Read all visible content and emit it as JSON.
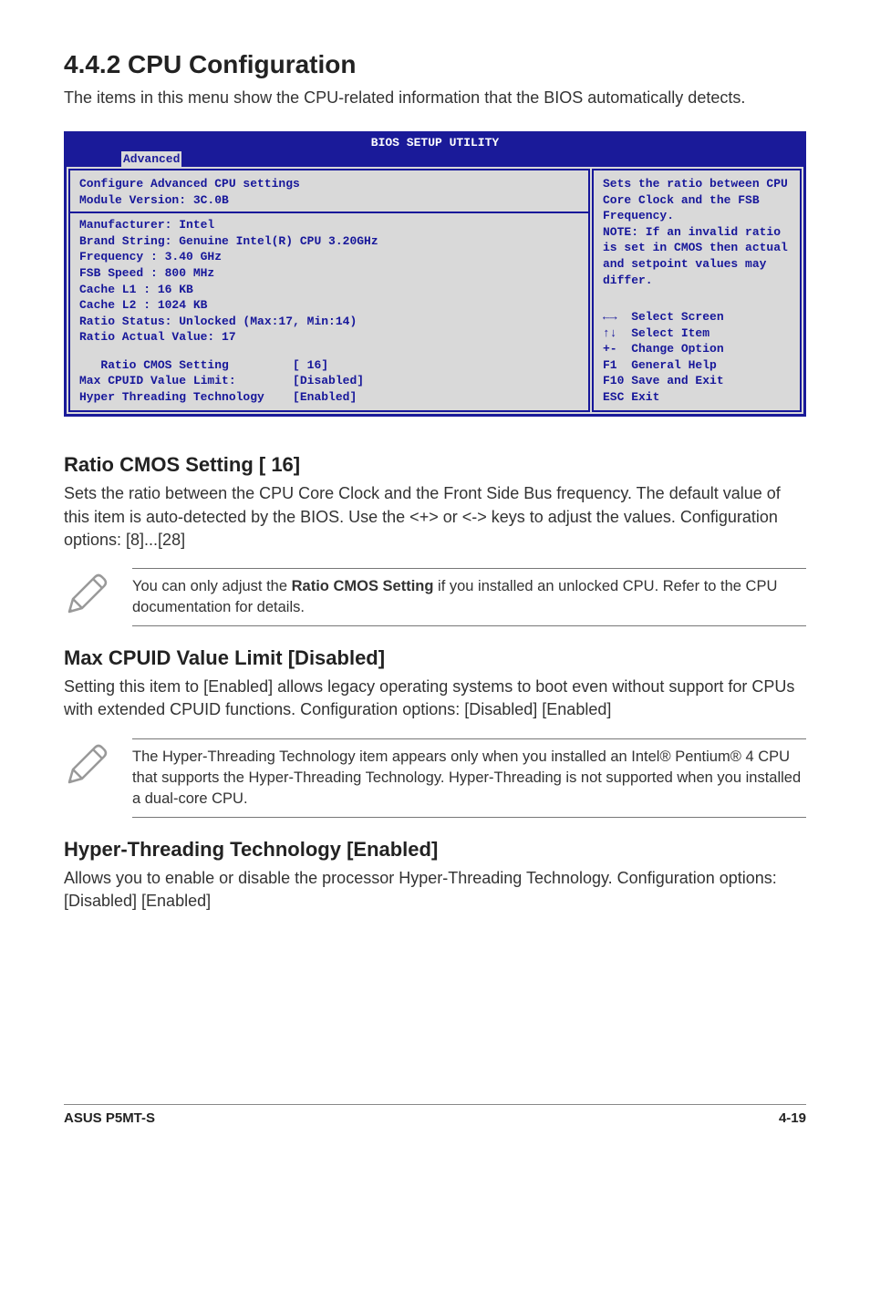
{
  "heading": "4.4.2   CPU Configuration",
  "intro": "The items in this menu show the CPU-related information that the BIOS automatically detects.",
  "bios": {
    "title": "BIOS SETUP UTILITY",
    "tab": "Advanced",
    "left_top": [
      "Configure Advanced CPU settings",
      "Module Version: 3C.0B"
    ],
    "left_info": [
      "Manufacturer: Intel",
      "Brand String: Genuine Intel(R) CPU 3.20GHz",
      "Frequency   : 3.40 GHz",
      "FSB Speed   : 800 MHz",
      "Cache L1    : 16 KB",
      "Cache L2    : 1024 KB",
      "Ratio Status: Unlocked (Max:17, Min:14)",
      "Ratio Actual Value: 17"
    ],
    "options": [
      {
        "label": "   Ratio CMOS Setting         ",
        "value": "[ 16]"
      },
      {
        "label": "Max CPUID Value Limit:        ",
        "value": "[Disabled]"
      },
      {
        "label": "Hyper Threading Technology    ",
        "value": "[Enabled]"
      }
    ],
    "help": "Sets the ratio between CPU Core Clock and the FSB Frequency.\nNOTE: If an invalid ratio is set in CMOS then actual and setpoint values may differ.",
    "keys": [
      "←→  Select Screen",
      "↑↓  Select Item",
      "+-  Change Option",
      "F1  General Help",
      "F10 Save and Exit",
      "ESC Exit"
    ]
  },
  "s1": {
    "title": "Ratio CMOS Setting [ 16]",
    "body": "Sets the ratio between the CPU Core Clock and the Front Side Bus frequency. The default value of this item is auto-detected by the BIOS. Use the <+> or <-> keys to adjust the values. Configuration options: [8]...[28]"
  },
  "note1_pre": "You can only adjust the ",
  "note1_bold": "Ratio CMOS Setting",
  "note1_post": " if you installed an unlocked CPU. Refer to the CPU documentation for details.",
  "s2": {
    "title": "Max CPUID Value Limit [Disabled]",
    "body": "Setting this item to [Enabled] allows legacy operating systems to boot even without support for CPUs with extended CPUID functions. Configuration options: [Disabled] [Enabled]"
  },
  "note2": "The Hyper-Threading Technology item appears only when you installed an Intel® Pentium® 4 CPU that supports the Hyper-Threading Technology. Hyper-Threading is not supported when you installed a dual-core CPU.",
  "s3": {
    "title": "Hyper-Threading Technology [Enabled]",
    "body": "Allows you to enable or disable the processor Hyper-Threading Technology. Configuration options: [Disabled] [Enabled]"
  },
  "footer_left": "ASUS P5MT-S",
  "footer_right": "4-19"
}
